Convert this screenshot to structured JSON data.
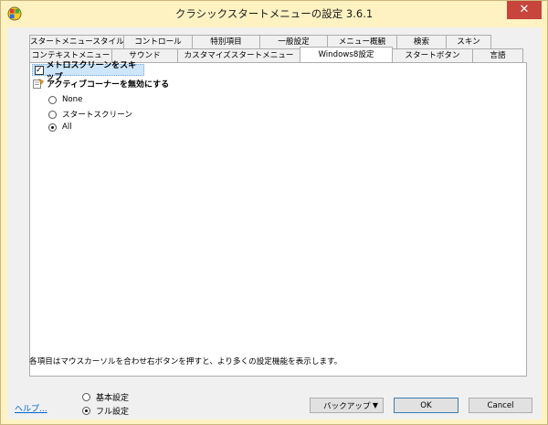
{
  "window": {
    "title": "クラシックスタートメニューの設定 3.6.1",
    "close_glyph": "✕"
  },
  "tabs_row1": [
    "スタートメニュースタイル",
    "コントロール",
    "特別項目",
    "一般設定",
    "メニュー概観",
    "検索",
    "スキン"
  ],
  "tabs_row2": [
    "コンテキストメニュー",
    "サウンド",
    "カスタマイズスタートメニュー",
    "Windows8設定",
    "スタートボタン",
    "言語"
  ],
  "active_tab": "Windows8設定",
  "settings": {
    "skip_metro": {
      "label": "メトロスクリーンをスキップ",
      "checked": true,
      "check_glyph": "✓"
    },
    "hot_corners": {
      "label": "アクティブコーナーを無効にする",
      "options": [
        {
          "label": "None",
          "selected": false
        },
        {
          "label": "スタートスクリーン",
          "selected": false
        },
        {
          "label": "All",
          "selected": true
        }
      ]
    }
  },
  "hint_text": "各項目はマウスカーソルを合わせ右ボタンを押すと、より多くの設定機能を表示します。",
  "footer": {
    "help_label": "ヘルプ...",
    "mode_options": [
      {
        "label": "基本設定",
        "selected": false
      },
      {
        "label": "フル設定",
        "selected": true
      }
    ],
    "backup_label": "バックアップ",
    "backup_arrow": "▼",
    "ok_label": "OK",
    "cancel_label": "Cancel"
  }
}
